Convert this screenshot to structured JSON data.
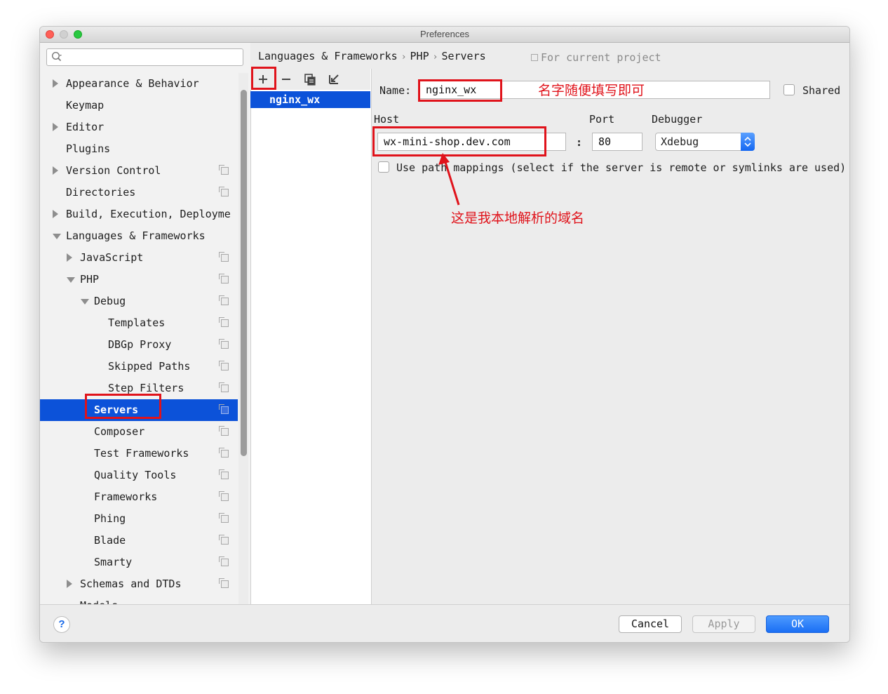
{
  "window": {
    "title": "Preferences"
  },
  "search": {
    "placeholder": "",
    "value": ""
  },
  "tree": [
    {
      "label": "Appearance & Behavior",
      "level": 0,
      "arrow": "right",
      "project": false,
      "selected": false
    },
    {
      "label": "Keymap",
      "level": 0,
      "arrow": "none",
      "project": false,
      "selected": false
    },
    {
      "label": "Editor",
      "level": 0,
      "arrow": "right",
      "project": false,
      "selected": false
    },
    {
      "label": "Plugins",
      "level": 0,
      "arrow": "none",
      "project": false,
      "selected": false
    },
    {
      "label": "Version Control",
      "level": 0,
      "arrow": "right",
      "project": true,
      "selected": false
    },
    {
      "label": "Directories",
      "level": 0,
      "arrow": "none",
      "project": true,
      "selected": false
    },
    {
      "label": "Build, Execution, Deployme",
      "level": 0,
      "arrow": "right",
      "project": false,
      "selected": false
    },
    {
      "label": "Languages & Frameworks",
      "level": 0,
      "arrow": "down",
      "project": false,
      "selected": false
    },
    {
      "label": "JavaScript",
      "level": 1,
      "arrow": "right",
      "project": true,
      "selected": false
    },
    {
      "label": "PHP",
      "level": 1,
      "arrow": "down",
      "project": true,
      "selected": false
    },
    {
      "label": "Debug",
      "level": 2,
      "arrow": "down",
      "project": true,
      "selected": false
    },
    {
      "label": "Templates",
      "level": 3,
      "arrow": "none",
      "project": true,
      "selected": false
    },
    {
      "label": "DBGp Proxy",
      "level": 3,
      "arrow": "none",
      "project": true,
      "selected": false
    },
    {
      "label": "Skipped Paths",
      "level": 3,
      "arrow": "none",
      "project": true,
      "selected": false
    },
    {
      "label": "Step Filters",
      "level": 3,
      "arrow": "none",
      "project": true,
      "selected": false
    },
    {
      "label": "Servers",
      "level": 2,
      "arrow": "none",
      "project": true,
      "selected": true
    },
    {
      "label": "Composer",
      "level": 2,
      "arrow": "none",
      "project": true,
      "selected": false
    },
    {
      "label": "Test Frameworks",
      "level": 2,
      "arrow": "none",
      "project": true,
      "selected": false
    },
    {
      "label": "Quality Tools",
      "level": 2,
      "arrow": "none",
      "project": true,
      "selected": false
    },
    {
      "label": "Frameworks",
      "level": 2,
      "arrow": "none",
      "project": true,
      "selected": false
    },
    {
      "label": "Phing",
      "level": 2,
      "arrow": "none",
      "project": true,
      "selected": false
    },
    {
      "label": "Blade",
      "level": 2,
      "arrow": "none",
      "project": true,
      "selected": false
    },
    {
      "label": "Smarty",
      "level": 2,
      "arrow": "none",
      "project": true,
      "selected": false
    },
    {
      "label": "Schemas and DTDs",
      "level": 1,
      "arrow": "right",
      "project": true,
      "selected": false
    },
    {
      "label": "Models",
      "level": 1,
      "arrow": "none",
      "project": false,
      "selected": false
    }
  ],
  "breadcrumb": {
    "items": [
      "Languages & Frameworks",
      "PHP",
      "Servers"
    ],
    "separator": "›"
  },
  "for_project": "For current project",
  "servers": {
    "list": [
      "nginx_wx"
    ]
  },
  "form": {
    "name_label": "Name:",
    "name_value": "nginx_wx",
    "shared_label": "Shared",
    "shared_checked": false,
    "host_label": "Host",
    "host_value": "wx-mini-shop.dev.com",
    "colon": ":",
    "port_label": "Port",
    "port_value": "80",
    "debugger_label": "Debugger",
    "debugger_value": "Xdebug",
    "path_mappings_label": "Use path mappings (select if the server is remote or symlinks are used)",
    "path_mappings_checked": false
  },
  "annotations": {
    "name_note": "名字随便填写即可",
    "host_note": "这是我本地解析的域名",
    "color": "#e0131b"
  },
  "buttons": {
    "help": "?",
    "cancel": "Cancel",
    "apply": "Apply",
    "ok": "OK"
  },
  "colors": {
    "selection": "#0c52d9",
    "ok_button": "#1a6ef4",
    "annotation": "#e0131b"
  },
  "icons": [
    "search-icon",
    "add-icon",
    "remove-icon",
    "copy-icon",
    "import-icon",
    "project-scope-icon",
    "help-icon"
  ]
}
